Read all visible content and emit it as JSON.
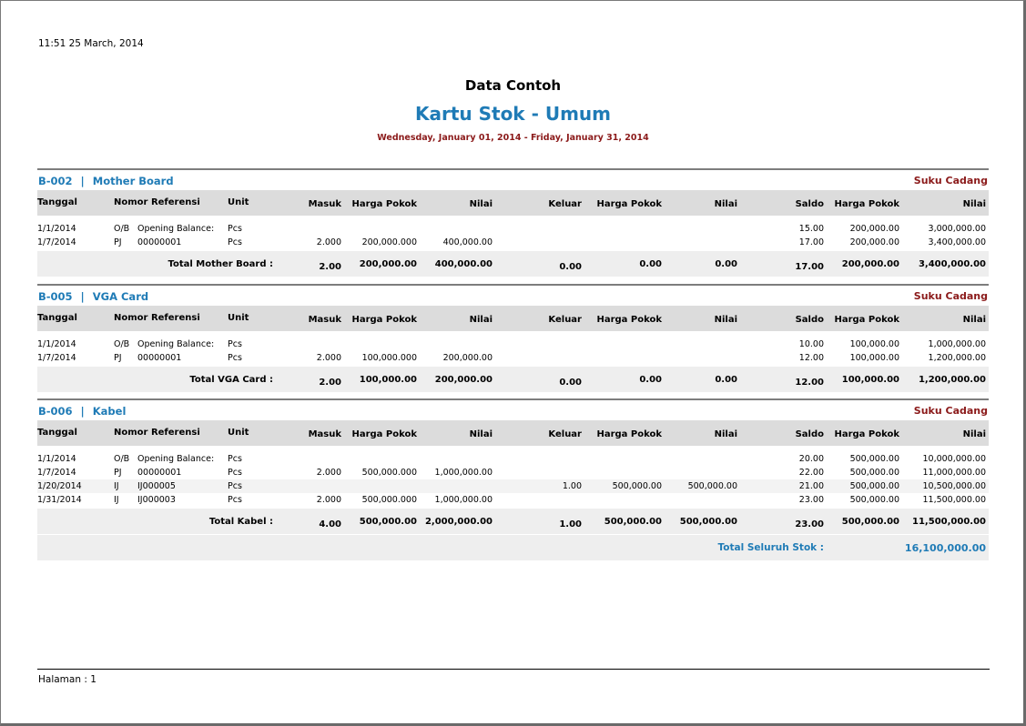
{
  "timestamp": "11:51   25 March, 2014",
  "company": "Data Contoh",
  "title": "Kartu Stok - Umum",
  "period": "Wednesday, January 01, 2014 - Friday, January 31, 2014",
  "columns": [
    "Tanggal",
    "Nomor Referensi",
    "Unit",
    "Masuk",
    "Harga Pokok",
    "Nilai",
    "Keluar",
    "Harga Pokok",
    "Nilai",
    "Saldo",
    "Harga Pokok",
    "Nilai"
  ],
  "sections": [
    {
      "code": "B-002",
      "separator": "|",
      "name": "Mother Board",
      "category": "Suku Cadang",
      "rows": [
        {
          "date": "1/1/2014",
          "type": "O/B",
          "ref": "Opening Balance:",
          "unit": "Pcs",
          "in_qty": "",
          "in_price": "",
          "in_value": "",
          "out_qty": "",
          "out_price": "",
          "out_value": "",
          "bal_qty": "15.00",
          "bal_price": "200,000.00",
          "bal_value": "3,000,000.00"
        },
        {
          "date": "1/7/2014",
          "type": "PJ",
          "ref": "00000001",
          "unit": "Pcs",
          "in_qty": "2.000",
          "in_price": "200,000.000",
          "in_value": "400,000.00",
          "out_qty": "",
          "out_price": "",
          "out_value": "",
          "bal_qty": "17.00",
          "bal_price": "200,000.00",
          "bal_value": "3,400,000.00"
        }
      ],
      "total": {
        "label": "Total Mother Board  :",
        "in_qty": "2.00",
        "in_price": "200,000.00",
        "in_value": "400,000.00",
        "out_qty": "0.00",
        "out_price": "0.00",
        "out_value": "0.00",
        "bal_qty": "17.00",
        "bal_price": "200,000.00",
        "bal_value": "3,400,000.00"
      }
    },
    {
      "code": "B-005",
      "separator": "|",
      "name": "VGA Card",
      "category": "Suku Cadang",
      "rows": [
        {
          "date": "1/1/2014",
          "type": "O/B",
          "ref": "Opening Balance:",
          "unit": "Pcs",
          "in_qty": "",
          "in_price": "",
          "in_value": "",
          "out_qty": "",
          "out_price": "",
          "out_value": "",
          "bal_qty": "10.00",
          "bal_price": "100,000.00",
          "bal_value": "1,000,000.00"
        },
        {
          "date": "1/7/2014",
          "type": "PJ",
          "ref": "00000001",
          "unit": "Pcs",
          "in_qty": "2.000",
          "in_price": "100,000.000",
          "in_value": "200,000.00",
          "out_qty": "",
          "out_price": "",
          "out_value": "",
          "bal_qty": "12.00",
          "bal_price": "100,000.00",
          "bal_value": "1,200,000.00"
        }
      ],
      "total": {
        "label": "Total VGA Card  :",
        "in_qty": "2.00",
        "in_price": "100,000.00",
        "in_value": "200,000.00",
        "out_qty": "0.00",
        "out_price": "0.00",
        "out_value": "0.00",
        "bal_qty": "12.00",
        "bal_price": "100,000.00",
        "bal_value": "1,200,000.00"
      }
    },
    {
      "code": "B-006",
      "separator": "|",
      "name": "Kabel",
      "category": "Suku Cadang",
      "rows": [
        {
          "date": "1/1/2014",
          "type": "O/B",
          "ref": "Opening Balance:",
          "unit": "Pcs",
          "in_qty": "",
          "in_price": "",
          "in_value": "",
          "out_qty": "",
          "out_price": "",
          "out_value": "",
          "bal_qty": "20.00",
          "bal_price": "500,000.00",
          "bal_value": "10,000,000.00"
        },
        {
          "date": "1/7/2014",
          "type": "PJ",
          "ref": "00000001",
          "unit": "Pcs",
          "in_qty": "2.000",
          "in_price": "500,000.000",
          "in_value": "1,000,000.00",
          "out_qty": "",
          "out_price": "",
          "out_value": "",
          "bal_qty": "22.00",
          "bal_price": "500,000.00",
          "bal_value": "11,000,000.00"
        },
        {
          "date": "1/20/2014",
          "type": "IJ",
          "ref": "IJ000005",
          "unit": "Pcs",
          "in_qty": "",
          "in_price": "",
          "in_value": "",
          "out_qty": "1.00",
          "out_price": "500,000.00",
          "out_value": "500,000.00",
          "bal_qty": "21.00",
          "bal_price": "500,000.00",
          "bal_value": "10,500,000.00"
        },
        {
          "date": "1/31/2014",
          "type": "IJ",
          "ref": "IJ000003",
          "unit": "Pcs",
          "in_qty": "2.000",
          "in_price": "500,000.000",
          "in_value": "1,000,000.00",
          "out_qty": "",
          "out_price": "",
          "out_value": "",
          "bal_qty": "23.00",
          "bal_price": "500,000.00",
          "bal_value": "11,500,000.00"
        }
      ],
      "total": {
        "label": "Total Kabel  :",
        "in_qty": "4.00",
        "in_price": "500,000.00",
        "in_value": "2,000,000.00",
        "out_qty": "1.00",
        "out_price": "500,000.00",
        "out_value": "500,000.00",
        "bal_qty": "23.00",
        "bal_price": "500,000.00",
        "bal_value": "11,500,000.00"
      }
    }
  ],
  "grand_total": {
    "label": "Total Seluruh Stok :",
    "value": "16,100,000.00"
  },
  "footer": {
    "page": "Halaman : 1"
  },
  "colors": {
    "accent": "#1f7bb6",
    "category": "#8b1a1a"
  }
}
